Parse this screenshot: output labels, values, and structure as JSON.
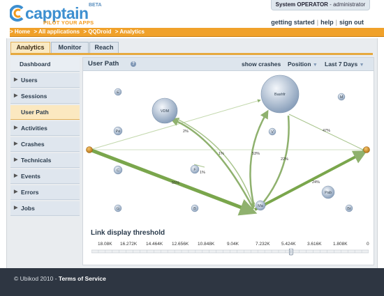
{
  "brand": {
    "name": "capptain",
    "beta": "BETA",
    "tagline": "PILOT YOUR APPS",
    "color_blue": "#3d8fd0",
    "color_orange": "#f39a1c"
  },
  "operator": {
    "role": "System OPERATOR",
    "sep": " - ",
    "user": "administrator"
  },
  "toplinks": {
    "getting_started": "getting started",
    "help": "help",
    "sign_out": "sign out"
  },
  "breadcrumb": {
    "items": [
      "> Home",
      "> All applications",
      "> QQDroid",
      "> Analytics"
    ]
  },
  "tabs": {
    "analytics": "Analytics",
    "monitor": "Monitor",
    "reach": "Reach"
  },
  "sidebar": {
    "items": [
      {
        "label": "Dashboard"
      },
      {
        "label": "Users"
      },
      {
        "label": "Sessions"
      },
      {
        "label": "User Path"
      },
      {
        "label": "Activities"
      },
      {
        "label": "Crashes"
      },
      {
        "label": "Technicals"
      },
      {
        "label": "Events"
      },
      {
        "label": "Errors"
      },
      {
        "label": "Jobs"
      }
    ],
    "arrow_glyph": "▶"
  },
  "panel": {
    "title": "User Path",
    "help_icon": "?",
    "show_crashes": "show crashes",
    "position": "Position",
    "period": "Last 7 Days",
    "dropdown_glyph": "▼"
  },
  "graph": {
    "nodes": [
      {
        "label": "E"
      },
      {
        "label": "VDM"
      },
      {
        "label": "Bashfr"
      },
      {
        "label": "M"
      },
      {
        "label": "Pe"
      },
      {
        "label": "V"
      },
      {
        "label": "C"
      },
      {
        "label": "F"
      },
      {
        "label": "Pab"
      },
      {
        "label": "G"
      },
      {
        "label": "B"
      },
      {
        "label": "Ma"
      },
      {
        "label": "Br"
      }
    ],
    "edge_labels": [
      "2%",
      "47%",
      "1%",
      "53%",
      "22%",
      "55%",
      "1%",
      "24%"
    ]
  },
  "threshold": {
    "title": "Link display threshold",
    "ticks": [
      "18.08K",
      "16.272K",
      "14.464K",
      "12.656K",
      "10.848K",
      "9.04K",
      "7.232K",
      "5.424K",
      "3.616K",
      "1.808K",
      "0"
    ],
    "selected_fraction": 0.72
  },
  "footer": {
    "copyright": "© Ubikod 2010 - ",
    "terms": "Terms of Service"
  }
}
